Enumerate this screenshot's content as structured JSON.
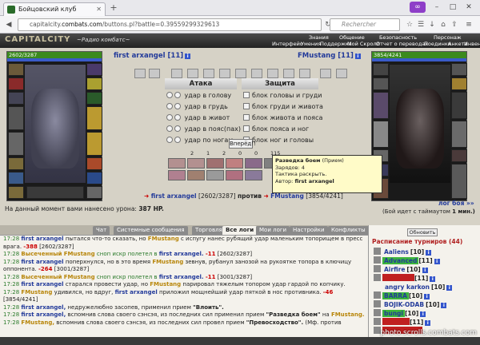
{
  "browser": {
    "tab_title": "Бойцовский клуб",
    "url_domain": "capitalcity.combats.com",
    "url_path": "/buttons.pl?battle=0.39559299329613",
    "url_prefix": "capitalcity.",
    "url_host": "combats.com",
    "search_placeholder": "Rechercher"
  },
  "game": {
    "logo": "CAPITALCITY",
    "radio": "~Радио комбатс~",
    "menu_top": [
      "Знания",
      "Общение",
      "Безопасность",
      "Персонаж"
    ],
    "menu_bottom": [
      "Интерфейс",
      "Умения",
      "Поддержка",
      "Мой Скролл",
      "Отчет о переводах",
      "Поединки",
      "Анкета",
      "Инвентарь"
    ],
    "left_hp": "2602/3287",
    "right_hp": "3854/4241",
    "left_name": "first arxangel",
    "left_level": "[11]",
    "right_name": "FMustang",
    "right_level": "[11]",
    "attack_title": "Атака",
    "defense_title": "Защита",
    "attack_options": [
      "удар в голову",
      "удар в грудь",
      "удар в живот",
      "удар в пояс(пах)",
      "удар по ногам"
    ],
    "defense_options": [
      "блок головы и груди",
      "блок груди и живота",
      "блок живота и пояса",
      "блок пояса и ног",
      "блок ног и головы"
    ],
    "go_button": "Вперёд!!",
    "counts": [
      "2",
      "1",
      "2",
      "0",
      "0",
      "115"
    ],
    "tooltip": {
      "title": "Разведка боем",
      "title_suffix": "(Прием)",
      "charge": "Зарядов: 4",
      "tactic": "Тактика раскрыть.",
      "author_label": "Автор:",
      "author": "first arxangel"
    },
    "vs_left_name": "first arxangel",
    "vs_left_hp": "[2602/3287]",
    "vs_word": "против",
    "vs_right_name": "FMustang",
    "vs_right_hp": "[3854/4241]",
    "log_link": "лог боя »»",
    "damage_text": "На данный момент вами нанесено урона:",
    "damage_value": "387 HP.",
    "timeout_text": "(Бой идет с таймаутом",
    "timeout_value": "1 мин.)"
  },
  "log_tabs": [
    "Чат",
    "Системные сообщения",
    "Торговля",
    "Все логи",
    "Мои логи",
    "Настройки",
    "Конфликты"
  ],
  "log_lines": [
    {
      "time": "17:28",
      "a": "first arxangel",
      "text": "пытался что-то сказать, но",
      "b": "FMustang",
      "text2": "с испугу нанес рубящий удар маленьким топорищем в пресс врага.",
      "dmg": "-388",
      "hp": "[2602/3287]"
    },
    {
      "time": "17:28",
      "a": "Высеченный",
      "b": "FMustang",
      "text": "сноп искр полетел в",
      "c": "first arxangel.",
      "dmg": "-11",
      "hp": "[2602/3287]"
    },
    {
      "time": "17:28",
      "a": "first arxangel",
      "text": "поперхнулся, но в это время",
      "b": "FMustang",
      "text2": "зевнув, рубанул занозой на рукоятке топора в ключицу оппонента.",
      "dmg": "-264",
      "hp": "[3001/3287]"
    },
    {
      "time": "17:28",
      "a": "Высеченный",
      "b": "FMustang",
      "text": "сноп искр полетел в",
      "c": "first arxangel.",
      "dmg": "-11",
      "hp": "[3001/3287]"
    },
    {
      "time": "17:28",
      "a": "first arxangel",
      "text": "старался провести удар, но",
      "b": "FMustang",
      "text2": "парировал тяжелым топором удар гардой по копчику."
    },
    {
      "time": "17:28",
      "a": "FMustang",
      "text": "удивился, но вдруг,",
      "b": "first arxangel",
      "text2": "приложил мощнейший удар пяткой в нос противника.",
      "dmg": "-46",
      "hp": "[3854/4241]"
    },
    {
      "time": "17:28",
      "a": "first arxangel,",
      "text": "недружелюбно засопев, применил прием",
      "q": "\"Влоить\"."
    },
    {
      "time": "17:28",
      "a": "first arxangel,",
      "text": "вспомнив слова своего сэнсэя, из последних сил применил прием",
      "q": "\"Разведка боем\"",
      "text2": "на",
      "b": "FMustang."
    },
    {
      "time": "17:28",
      "a": "FMustang,",
      "text": "вспомнив слова своего сэнсэя, из последних сил провел прием",
      "q": "\"Превосходство\".",
      "text2": "(Мф. против"
    }
  ],
  "sidebar": {
    "refresh": "Обновить",
    "schedule_title": "Расписание турниров (44)",
    "players": [
      {
        "name": "Aaliens",
        "level": "[10]",
        "hl": ""
      },
      {
        "name": "Advanced",
        "level": "[11]",
        "hl": "#3cb43c"
      },
      {
        "name": "Airfire",
        "level": "[10]",
        "hl": ""
      },
      {
        "name": "",
        "level": "[11]",
        "hl": "#c02020"
      },
      {
        "name": "angry karkon",
        "level": "[10]",
        "hl": ""
      },
      {
        "name": "BARRA",
        "level": "[10]",
        "hl": "#3cb43c"
      },
      {
        "name": "BOJIK-ODAB",
        "level": "[10]",
        "hl": ""
      },
      {
        "name": "bungi",
        "level": "[10]",
        "hl": "#3cb43c"
      },
      {
        "name": "",
        "level": "[11]",
        "hl": "#c02020"
      },
      {
        "name": "",
        "level": "",
        "hl": "#c02020"
      }
    ]
  },
  "watermark": "photo.scrolls.combats.com",
  "colors": {
    "accent": "#223a9a",
    "hp": "#3b8a1e",
    "mp": "#3a5bc8",
    "orange": "#b8860b"
  }
}
